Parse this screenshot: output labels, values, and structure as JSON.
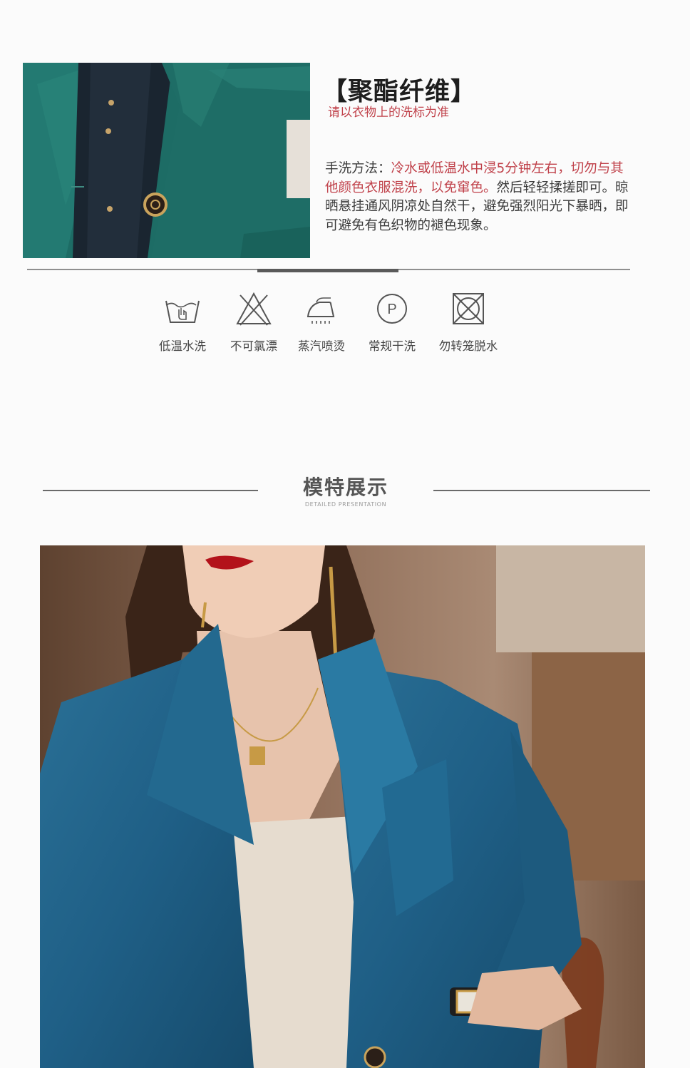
{
  "fabric": {
    "title": "【聚酯纤维】",
    "note": "请以衣物上的洗标为准",
    "care_prefix": "手洗方法：",
    "care_highlight": "冷水或低温水中浸5分钟左右，切勿与其他颜色衣服混洗，以免窜色。",
    "care_rest": "然后轻轻揉搓即可。晾晒悬挂通风阴凉处自然干，避免强烈阳光下暴晒，即可避免有色织物的褪色现象。"
  },
  "care_icons": [
    {
      "icon": "low-temp-wash-icon",
      "label": "低温水洗"
    },
    {
      "icon": "no-bleach-icon",
      "label": "不可氯漂"
    },
    {
      "icon": "steam-iron-icon",
      "label": "蒸汽喷烫"
    },
    {
      "icon": "dry-clean-icon",
      "label": "常规干洗"
    },
    {
      "icon": "no-tumble-dry-icon",
      "label": "勿转笼脱水"
    }
  ],
  "section": {
    "title": "模特展示",
    "subtitle": "DETAILED PRESENTATION"
  },
  "colors": {
    "accent_red": "#c0414a",
    "jacket_teal": "#1f6e67",
    "jacket_blue": "#1f5f86"
  }
}
